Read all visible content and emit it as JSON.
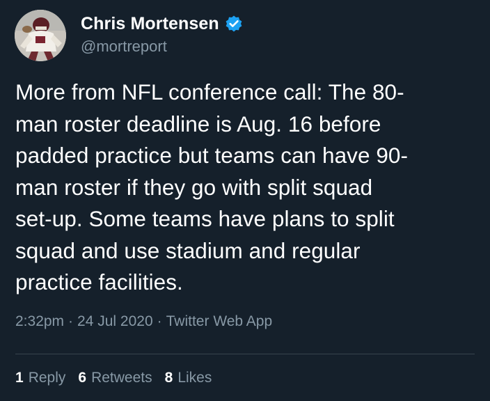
{
  "user": {
    "display_name": "Chris Mortensen",
    "handle": "@mortreport",
    "verified_icon": "verified-badge-icon"
  },
  "tweet": {
    "text": "More from NFL conference call: The 80-\nman roster deadline is Aug. 16 before\npadded practice but teams can have 90-\nman roster if they go with split squad\nset-up. Some teams have plans to split\nsquad and use stadium and regular\npractice facilities."
  },
  "meta": {
    "time": "2:32pm",
    "separator": "·",
    "date": "24 Jul 2020",
    "source": "Twitter Web App"
  },
  "stats": {
    "replies_count": "1",
    "replies_label": "Reply",
    "retweets_count": "6",
    "retweets_label": "Retweets",
    "likes_count": "8",
    "likes_label": "Likes"
  },
  "colors": {
    "background": "#15202b",
    "secondary_text": "#8899a6",
    "verified_blue": "#1da1f2",
    "divider": "#38444d"
  }
}
